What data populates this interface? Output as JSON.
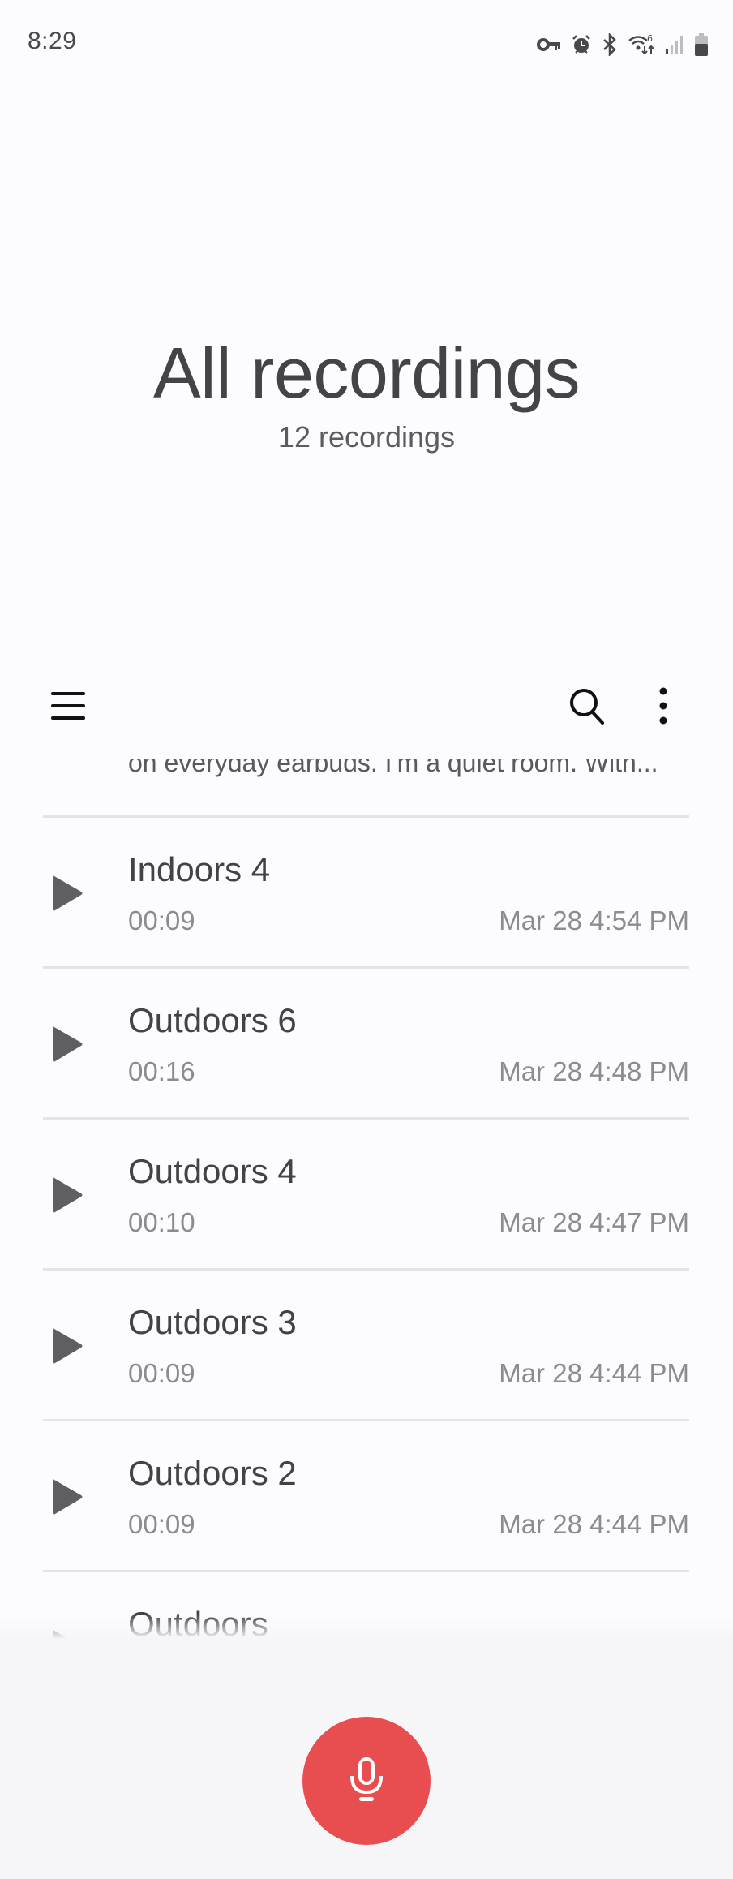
{
  "status_bar": {
    "time": "8:29",
    "icons": [
      "vpn-key-icon",
      "alarm-icon",
      "bluetooth-icon",
      "wifi-6-icon",
      "cellular-signal-icon",
      "battery-icon"
    ]
  },
  "header": {
    "title": "All recordings",
    "count": "12 recordings"
  },
  "toolbar": {
    "menu_icon": "hamburger-menu-icon",
    "search_icon": "search-icon",
    "more_icon": "more-options-icon"
  },
  "list": {
    "clipped_snippet": "on everyday earbuds. I'm a quiet room. With...",
    "recordings": [
      {
        "name": "Indoors 4",
        "duration": "00:09",
        "date": "Mar 28 4:54 PM"
      },
      {
        "name": "Outdoors 6",
        "duration": "00:16",
        "date": "Mar 28 4:48 PM"
      },
      {
        "name": "Outdoors 4",
        "duration": "00:10",
        "date": "Mar 28 4:47 PM"
      },
      {
        "name": "Outdoors 3",
        "duration": "00:09",
        "date": "Mar 28 4:44 PM"
      },
      {
        "name": "Outdoors 2",
        "duration": "00:09",
        "date": "Mar 28 4:44 PM"
      },
      {
        "name": "Outdoors",
        "duration": "",
        "date": ""
      }
    ]
  },
  "record_button": {
    "icon": "microphone-icon",
    "color": "#e84d50"
  }
}
